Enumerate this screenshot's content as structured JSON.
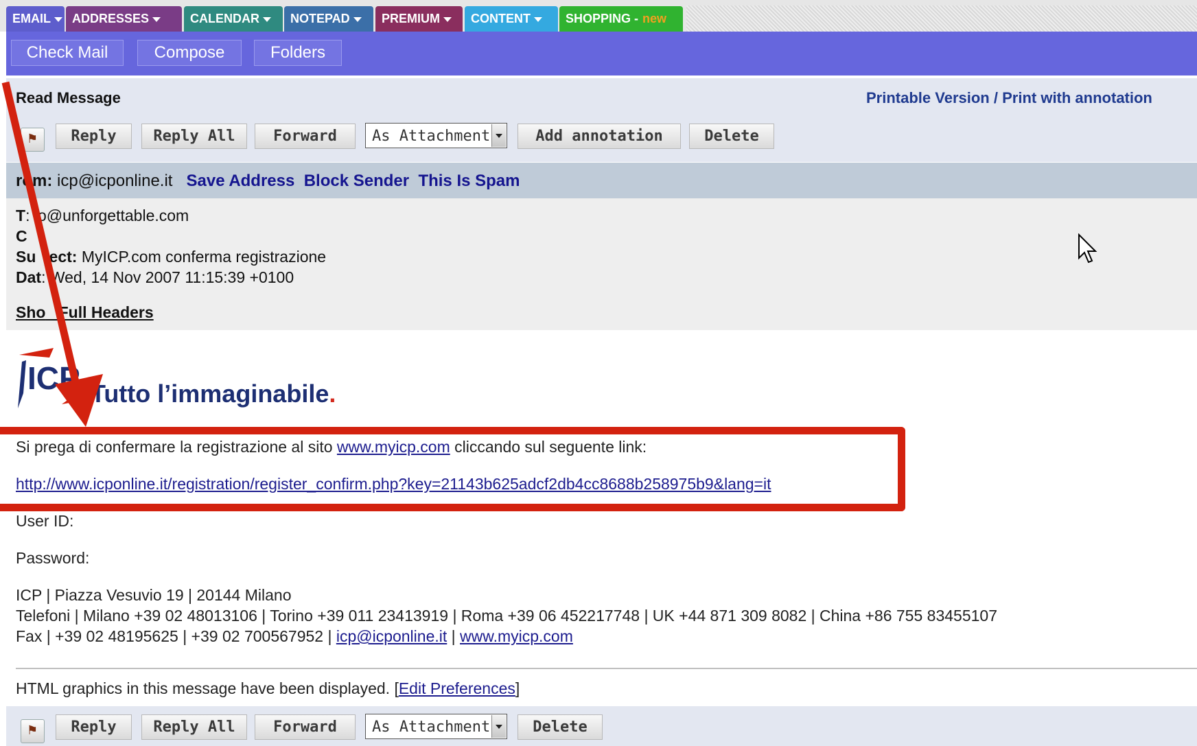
{
  "tabs": [
    {
      "label": "EMAIL",
      "color": "#5d5dcc"
    },
    {
      "label": "ADDRESSES",
      "color": "#7a3c86"
    },
    {
      "label": "CALENDAR",
      "color": "#2f8a80"
    },
    {
      "label": "NOTEPAD",
      "color": "#3b6fa8"
    },
    {
      "label": "PREMIUM",
      "color": "#8a2e5e"
    },
    {
      "label": "CONTENT",
      "color": "#34a9e0"
    },
    {
      "label": "SHOPPING -",
      "badge": "new",
      "color": "#30b330"
    }
  ],
  "toolbar": {
    "check_mail": "Check Mail",
    "compose": "Compose",
    "folders": "Folders"
  },
  "read": {
    "title": "Read Message",
    "printable": "Printable Version",
    "separator": "/",
    "print_annotation": "Print with annotation"
  },
  "actions": {
    "reply": "Reply",
    "reply_all": "Reply All",
    "forward": "Forward",
    "forward_mode": "As Attachment",
    "add_annotation": "Add annotation",
    "delete": "Delete"
  },
  "message": {
    "from_label": "rom:",
    "from": "icp@icponline.it",
    "save_address": "Save Address",
    "block_sender": "Block Sender",
    "spam": "This Is Spam",
    "to_label": "T",
    "to": ": io@unforgettable.com",
    "cc_label": "C",
    "subject_label_a": "Su",
    "subject_label_b": "ject:",
    "subject": "MyICP.com conferma registrazione",
    "date_label": "Dat",
    "date": ": Wed, 14 Nov 2007 11:15:39 +0100",
    "show_headers_a": "Sho",
    "show_headers_b": "Full Headers"
  },
  "body": {
    "logo_text": "ICP",
    "tagline": "Tutto l’immaginabile",
    "tagline_dot": ".",
    "confirm_pre": "Si prega di confermare la registrazione al sito ",
    "confirm_link": "www.myicp.com",
    "confirm_post": " cliccando sul seguente link:",
    "confirm_url": "http://www.icponline.it/registration/register_confirm.php?key=21143b625adcf2db4cc8688b258975b9&lang=it",
    "userid_label": "User ID:",
    "password_label": "Password:",
    "address": "ICP | Piazza Vesuvio 19 | 20144 Milano",
    "phones": "Telefoni | Milano +39 02 48013106 | Torino +39 011 23413919 | Roma +39 06 452217748 | UK +44 871 309 8082 | China +86 755 83455107",
    "fax_pre": "Fax | +39 02 48195625 | +39 02 700567952 | ",
    "fax_email": "icp@icponline.it",
    "fax_sep": " | ",
    "fax_web": "www.myicp.com",
    "prefs_pre": "HTML graphics in this message have been displayed. [",
    "prefs_link": "Edit Preferences",
    "prefs_post": "]"
  },
  "colors": {
    "annotation": "#d3220f",
    "toolbar": "#6666dd",
    "link": "#1c1c8e"
  }
}
